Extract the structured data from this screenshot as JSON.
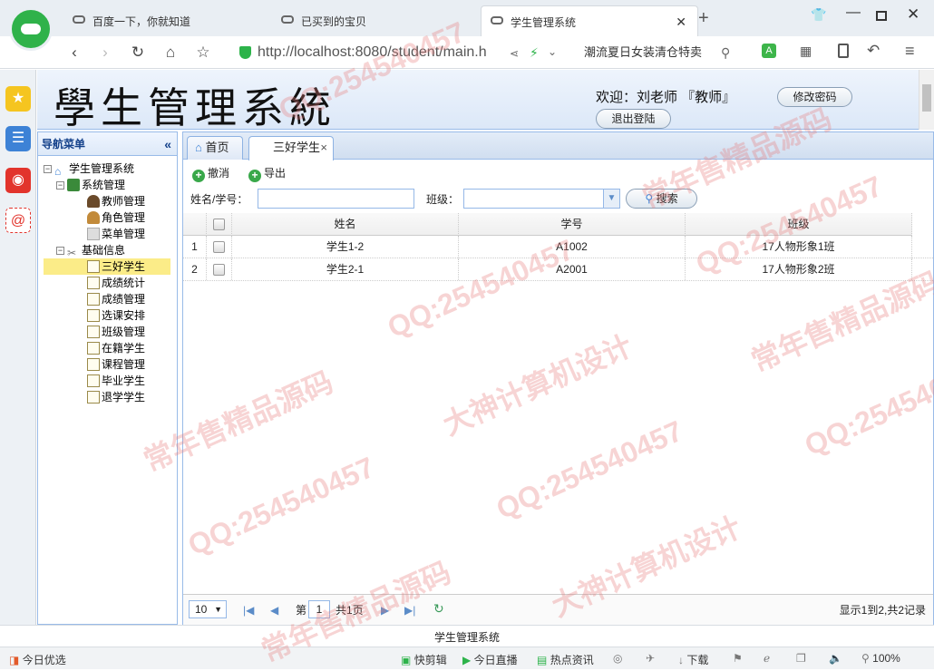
{
  "browser": {
    "tabs": [
      {
        "label": "百度一下，你就知道"
      },
      {
        "label": "已买到的宝贝"
      },
      {
        "label": "学生管理系统",
        "active": true
      }
    ],
    "new_tab_label": "+",
    "url": "http://localhost:8080/student/main.h",
    "search_text": "潮流夏日女装清仓特卖",
    "zoom": "100%"
  },
  "app": {
    "title": "學生管理系統",
    "welcome": "欢迎：刘老师 『教师』",
    "change_password": "修改密码",
    "logout": "退出登陆"
  },
  "nav": {
    "header": "导航菜单",
    "collapse_icon": "«",
    "root": "学生管理系统",
    "groups": [
      {
        "label": "系统管理",
        "items": [
          "教师管理",
          "角色管理",
          "菜单管理"
        ]
      },
      {
        "label": "基础信息",
        "items": [
          "三好学生",
          "成绩统计",
          "成绩管理",
          "选课安排",
          "班级管理",
          "在籍学生",
          "课程管理",
          "毕业学生",
          "退学学生"
        ]
      }
    ],
    "selected_item": "三好学生"
  },
  "content_tabs": [
    {
      "label": "首页"
    },
    {
      "label": "三好学生",
      "closable": true,
      "active": true
    }
  ],
  "toolbar": {
    "cancel": "撤消",
    "export": "导出"
  },
  "filter": {
    "name_label": "姓名/学号：",
    "class_label": "班级：",
    "search_btn": "搜索"
  },
  "grid": {
    "columns": [
      "姓名",
      "学号",
      "班级"
    ],
    "rows": [
      {
        "num": "1",
        "name": "学生1-2",
        "id": "A1002",
        "class": "17人物形象1班"
      },
      {
        "num": "2",
        "name": "学生2-1",
        "id": "A2001",
        "class": "17人物形象2班"
      }
    ]
  },
  "pager": {
    "page_size": "10",
    "page_prefix": "第",
    "page_value": "1",
    "page_total": "共1页",
    "summary": "显示1到2,共2记录"
  },
  "footer": {
    "title": "学生管理系统"
  },
  "statusbar": {
    "left": "今日优选",
    "items": [
      "快剪辑",
      "今日直播",
      "热点资讯",
      "下载"
    ]
  },
  "watermarks": [
    "QQ:254540457",
    "大神计算机设计",
    "常年售精品源码"
  ]
}
